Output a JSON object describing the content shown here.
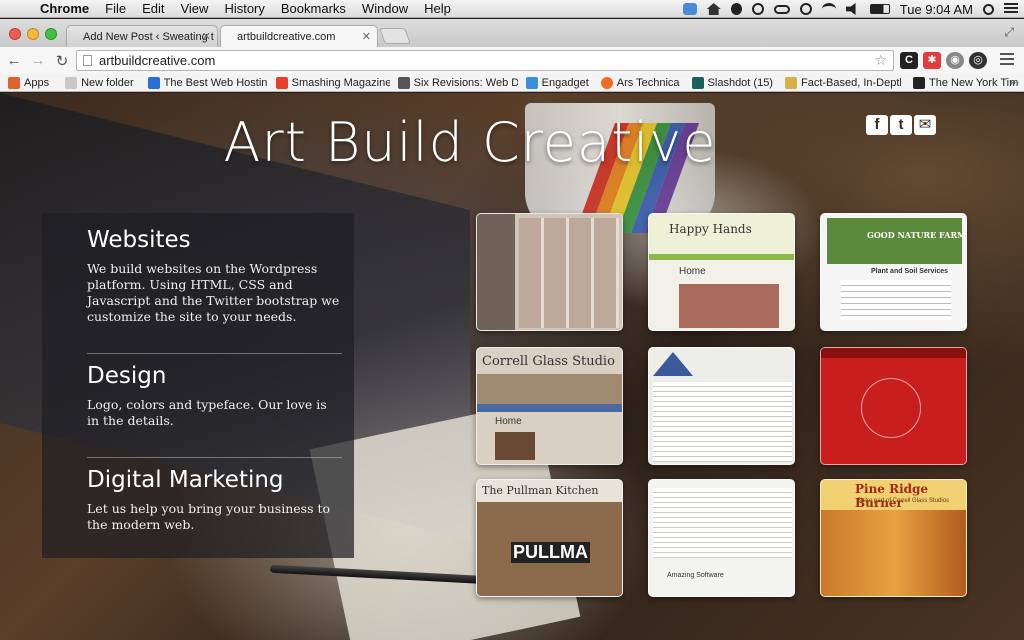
{
  "menubar": {
    "app": "Chrome",
    "items": [
      "File",
      "Edit",
      "View",
      "History",
      "Bookmarks",
      "Window",
      "Help"
    ],
    "clock": "Tue 9:04 AM"
  },
  "browser": {
    "tabs": [
      {
        "title": "Add New Post ‹ Sweating t",
        "active": false
      },
      {
        "title": "artbuildcreative.com",
        "active": true
      }
    ],
    "url": "artbuildcreative.com",
    "bookmarks": [
      {
        "label": "Apps",
        "icon": "apps-icon",
        "color": "#e0622a"
      },
      {
        "label": "New folder",
        "icon": "folder-icon",
        "color": "#c8c8c8"
      },
      {
        "label": "The Best Web Hostin",
        "icon": "grid-icon",
        "color": "#2a6fd4"
      },
      {
        "label": "Smashing Magazine",
        "icon": "smashing-icon",
        "color": "#e8402b"
      },
      {
        "label": "Six Revisions: Web D",
        "icon": "sr-icon",
        "color": "#555555"
      },
      {
        "label": "Engadget",
        "icon": "engadget-icon",
        "color": "#3a8fd8"
      },
      {
        "label": "Ars Technica",
        "icon": "ars-icon",
        "color": "#f06d23"
      },
      {
        "label": "Slashdot (15)",
        "icon": "slashdot-icon",
        "color": "#1d5e5e"
      },
      {
        "label": "Fact-Based, In-Depth",
        "icon": "fact-icon",
        "color": "#d8b04a"
      },
      {
        "label": "The New York Times",
        "icon": "nyt-icon",
        "color": "#222222"
      }
    ]
  },
  "site": {
    "title": "Art Build Creative",
    "social": [
      "f",
      "t",
      "✉"
    ],
    "services": [
      {
        "heading": "Websites",
        "text": "We build websites on the Wordpress platform. Using HTML, CSS and Javascript and the Twitter bootstrap we customize the site to your needs."
      },
      {
        "heading": "Design",
        "text": "Logo, colors and typeface. Our love is in the details."
      },
      {
        "heading": "Digital Marketing",
        "text": "Let us help you bring your business to the modern web."
      }
    ],
    "portfolio": [
      {
        "label": "",
        "sub": "",
        "theme": "collage"
      },
      {
        "label": "Happy Hands",
        "sub": "Home",
        "theme": "happy"
      },
      {
        "label": "GOOD NATURE FARM",
        "sub": "Plant and Soil Services",
        "theme": "farm"
      },
      {
        "label": "Correll Glass Studio",
        "sub": "Home",
        "theme": "glass"
      },
      {
        "label": "",
        "sub": "",
        "theme": "church"
      },
      {
        "label": "",
        "sub": "",
        "theme": "red"
      },
      {
        "label": "The Pullman Kitchen",
        "sub": "PULLMA",
        "theme": "pullman"
      },
      {
        "label": "",
        "sub": "Amazing Software",
        "theme": "software"
      },
      {
        "label": "Pine Ridge Burner",
        "sub": "Sister part of Correll Glass Studios",
        "theme": "pine"
      }
    ]
  }
}
